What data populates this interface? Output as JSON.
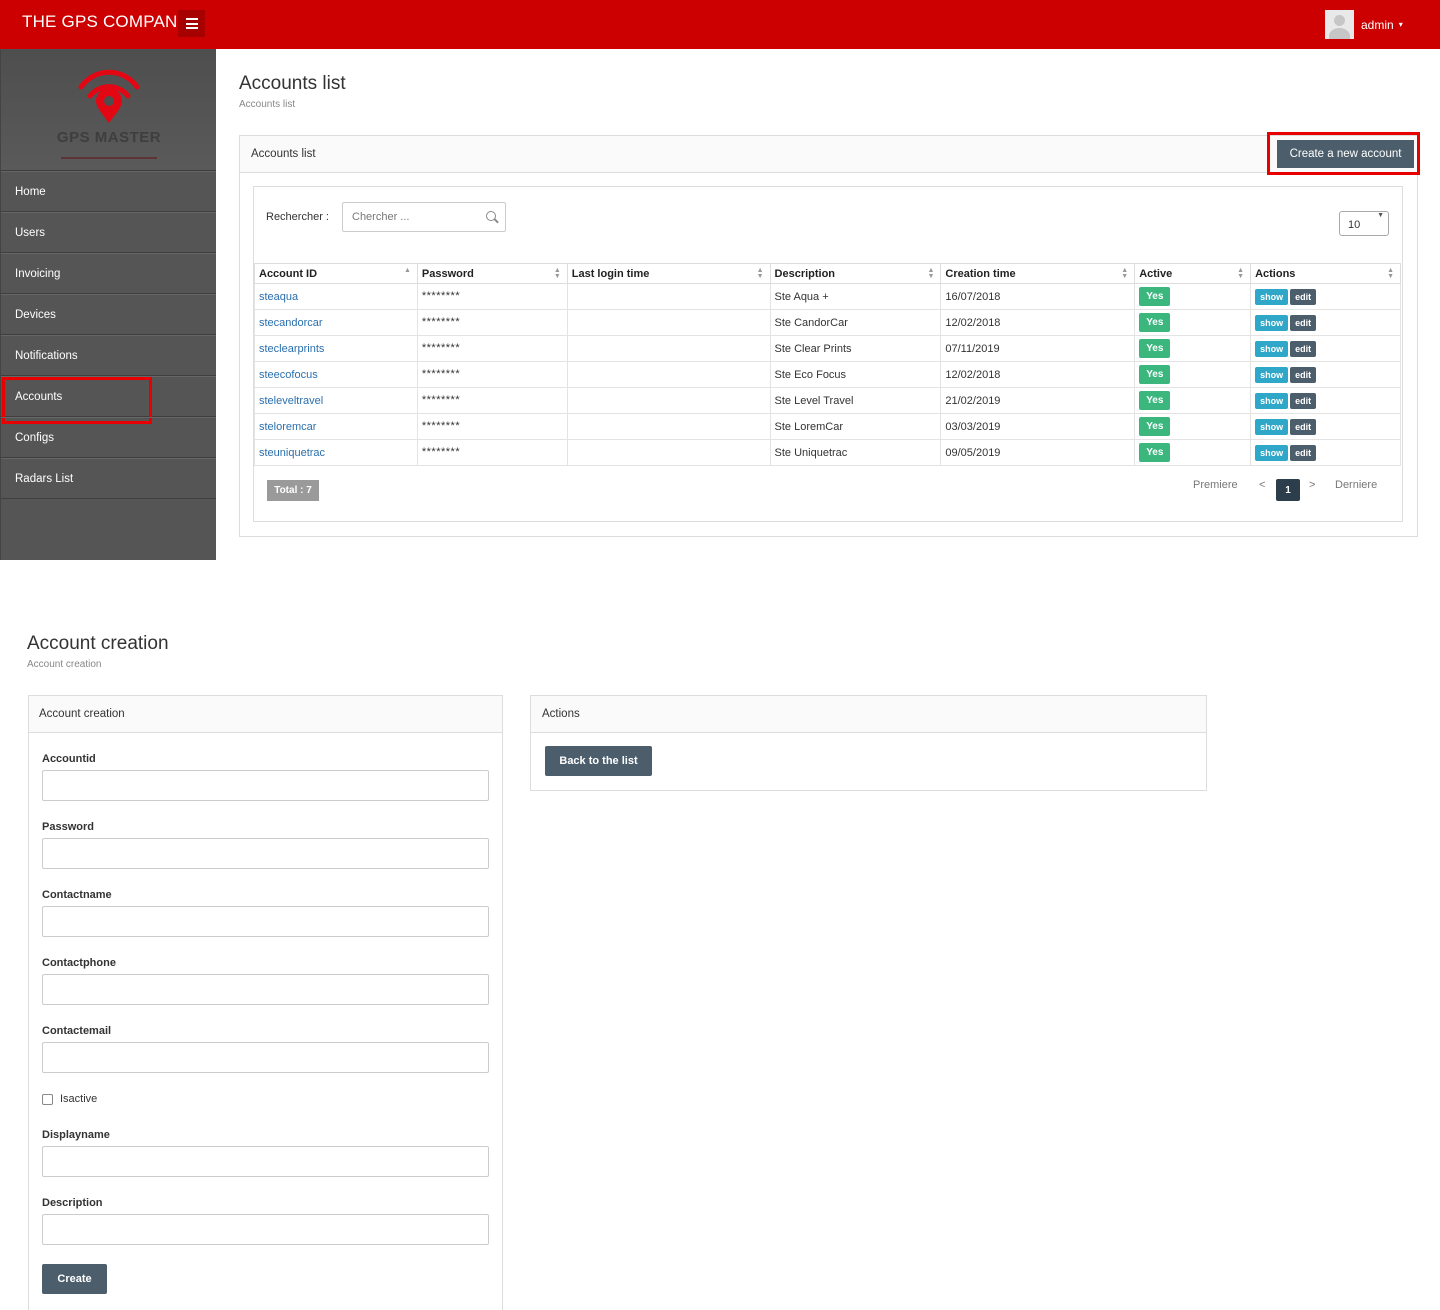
{
  "header": {
    "brand": "THE GPS COMPANY",
    "user": "admin",
    "caret": "▾"
  },
  "colors": {
    "topbar": "#cc0000",
    "sidebar": "#555555",
    "primary_button": "#4c5e6b",
    "active_badge": "#3bb77e",
    "show_button": "#2ea7c9",
    "highlight": "#e80000"
  },
  "sidebar": {
    "logo_text": "GPS MASTER",
    "items": [
      {
        "label": "Home"
      },
      {
        "label": "Users"
      },
      {
        "label": "Invoicing"
      },
      {
        "label": "Devices"
      },
      {
        "label": "Notifications"
      },
      {
        "label": "Accounts"
      },
      {
        "label": "Configs"
      },
      {
        "label": "Radars List"
      }
    ]
  },
  "accounts_list": {
    "title": "Accounts list",
    "subtitle": "Accounts list",
    "panel_title": "Accounts list",
    "create_button": "Create a new account",
    "search_label": "Rechercher :",
    "search_placeholder": "Chercher ...",
    "page_size": "10",
    "columns": [
      "Account ID",
      "Password",
      "Last login time",
      "Description",
      "Creation time",
      "Active",
      "Actions"
    ],
    "rows": [
      {
        "id": "steaqua",
        "password": "********",
        "last_login": "",
        "description": "Ste Aqua +",
        "created": "16/07/2018",
        "active": "Yes"
      },
      {
        "id": "stecandorcar",
        "password": "********",
        "last_login": "",
        "description": "Ste CandorCar",
        "created": "12/02/2018",
        "active": "Yes"
      },
      {
        "id": "steclearprints",
        "password": "********",
        "last_login": "",
        "description": "Ste Clear Prints",
        "created": "07/11/2019",
        "active": "Yes"
      },
      {
        "id": "steecofocus",
        "password": "********",
        "last_login": "",
        "description": "Ste Eco Focus",
        "created": "12/02/2018",
        "active": "Yes"
      },
      {
        "id": "steleveltravel",
        "password": "********",
        "last_login": "",
        "description": "Ste Level Travel",
        "created": "21/02/2019",
        "active": "Yes"
      },
      {
        "id": "steloremcar",
        "password": "********",
        "last_login": "",
        "description": "Ste LoremCar",
        "created": "03/03/2019",
        "active": "Yes"
      },
      {
        "id": "steuniquetrac",
        "password": "********",
        "last_login": "",
        "description": "Ste Uniquetrac",
        "created": "09/05/2019",
        "active": "Yes"
      }
    ],
    "action_show": "show",
    "action_edit": "edit",
    "total": "Total : 7",
    "pager": {
      "first": "Premiere",
      "prev": "<",
      "current": "1",
      "next": ">",
      "last": "Derniere"
    }
  },
  "account_creation": {
    "title": "Account creation",
    "subtitle": "Account creation",
    "panel_title": "Account creation",
    "fields": {
      "accountid": "Accountid",
      "password": "Password",
      "contactname": "Contactname",
      "contactphone": "Contactphone",
      "contactemail": "Contactemail",
      "isactive": "Isactive",
      "displayname": "Displayname",
      "description": "Description"
    },
    "submit": "Create",
    "actions_title": "Actions",
    "back_button": "Back to the list"
  }
}
